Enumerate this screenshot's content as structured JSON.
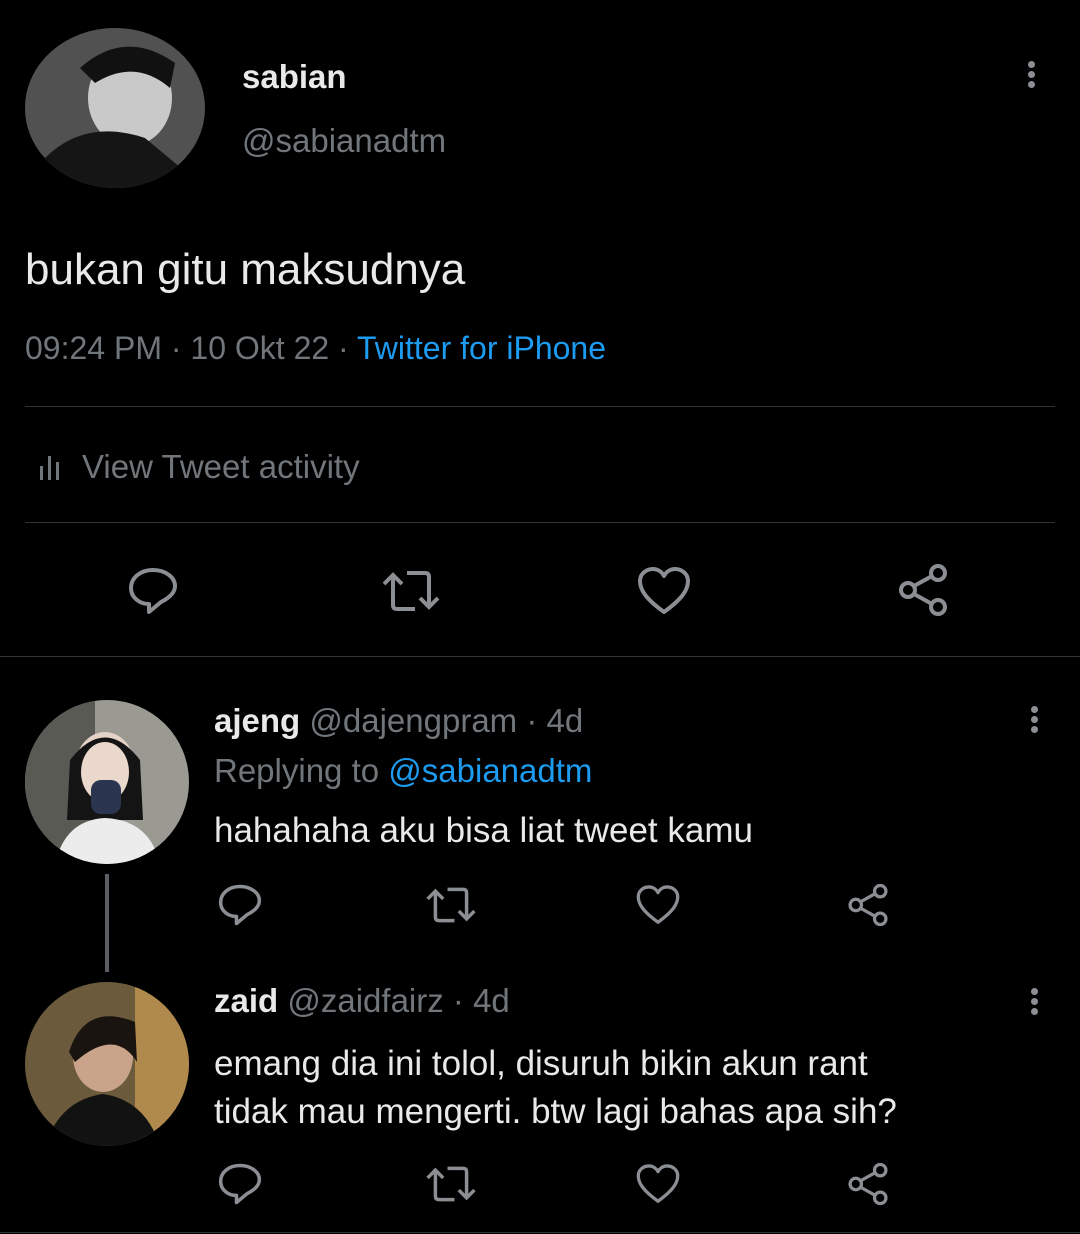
{
  "main_tweet": {
    "author_name": "sabian",
    "author_handle": "@sabianadtm",
    "text": "bukan gitu maksudnya",
    "time": "09:24 PM",
    "date": "10 Okt 22",
    "separator": "·",
    "source": "Twitter for iPhone",
    "activity_label": "View Tweet activity",
    "more_icon": "more-vertical-icon"
  },
  "replies": [
    {
      "author_name": "ajeng",
      "author_handle": "@dajengpram",
      "age": "· 4d",
      "replying_prefix": "Replying to",
      "replying_to": "@sabianadtm",
      "text": "hahahaha aku bisa liat tweet kamu"
    },
    {
      "author_name": "zaid",
      "author_handle": "@zaidfairz",
      "age": "· 4d",
      "text_line1": "emang dia ini tolol, disuruh bikin akun rant",
      "text_line2": "tidak mau mengerti. btw lagi bahas apa sih?"
    }
  ],
  "actions": [
    "reply-icon",
    "retweet-icon",
    "like-icon",
    "share-icon"
  ],
  "colors": {
    "background": "#000000",
    "text": "#e7e9ea",
    "muted": "#71767b",
    "link": "#1d9bf0",
    "divider": "#2f3336"
  }
}
